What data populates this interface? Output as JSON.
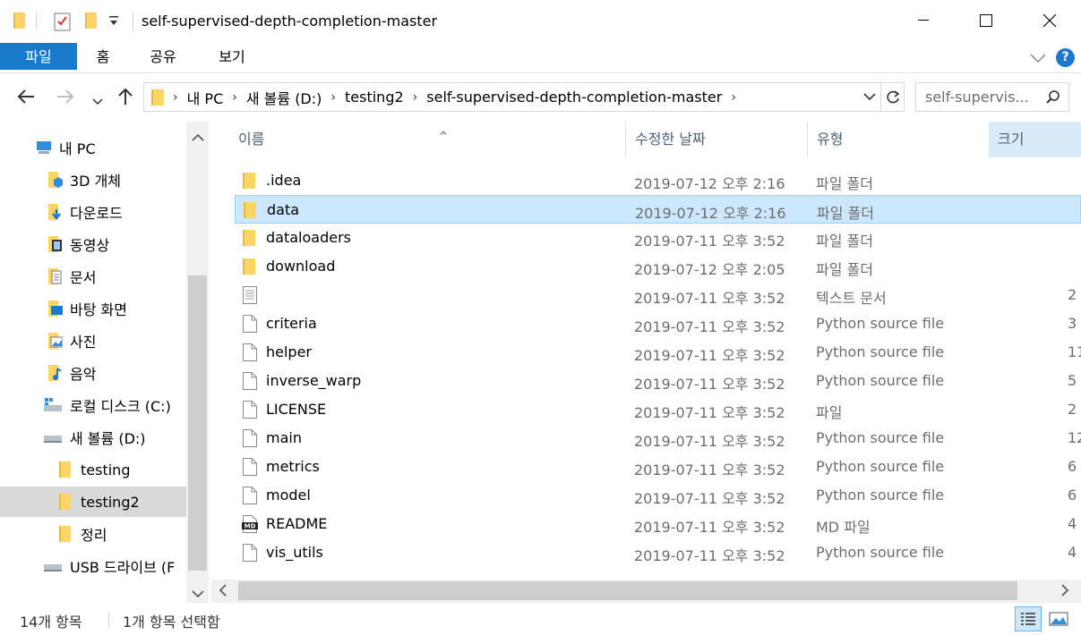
{
  "window": {
    "title": "self-supervised-depth-completion-master"
  },
  "ribbon": {
    "tabs": [
      "파일",
      "홈",
      "공유",
      "보기"
    ]
  },
  "address": {
    "crumbs": [
      "내 PC",
      "새 볼륨 (D:)",
      "testing2",
      "self-supervised-depth-completion-master"
    ]
  },
  "search": {
    "placeholder": "self-supervis..."
  },
  "tree": [
    {
      "label": "내 PC",
      "icon": "computer-icon"
    },
    {
      "label": "3D 개체",
      "icon": "3d-objects-icon"
    },
    {
      "label": "다운로드",
      "icon": "downloads-icon"
    },
    {
      "label": "동영상",
      "icon": "videos-icon"
    },
    {
      "label": "문서",
      "icon": "documents-icon"
    },
    {
      "label": "바탕 화면",
      "icon": "desktop-icon"
    },
    {
      "label": "사진",
      "icon": "pictures-icon"
    },
    {
      "label": "음악",
      "icon": "music-icon"
    },
    {
      "label": "로컬 디스크 (C:)",
      "icon": "drive-icon"
    },
    {
      "label": "새 볼륨 (D:)",
      "icon": "drive-icon"
    },
    {
      "label": "testing",
      "icon": "folder-icon"
    },
    {
      "label": "testing2",
      "icon": "folder-icon"
    },
    {
      "label": "정리",
      "icon": "folder-icon"
    },
    {
      "label": "USB 드라이브 (F",
      "icon": "usb-drive-icon"
    }
  ],
  "columns": {
    "name": "이름",
    "date": "수정한 날짜",
    "type": "유형",
    "size": "크기"
  },
  "files": [
    {
      "name": ".idea",
      "date": "2019-07-12 오후 2:16",
      "type": "파일 폴더",
      "size": "",
      "icon": "folder"
    },
    {
      "name": "data",
      "date": "2019-07-12 오후 2:16",
      "type": "파일 폴더",
      "size": "",
      "icon": "folder"
    },
    {
      "name": "dataloaders",
      "date": "2019-07-11 오후 3:52",
      "type": "파일 폴더",
      "size": "",
      "icon": "folder"
    },
    {
      "name": "download",
      "date": "2019-07-12 오후 2:05",
      "type": "파일 폴더",
      "size": "",
      "icon": "folder"
    },
    {
      "name": "",
      "date": "2019-07-11 오후 3:52",
      "type": "텍스트 문서",
      "size": "2",
      "icon": "text"
    },
    {
      "name": "criteria",
      "date": "2019-07-11 오후 3:52",
      "type": "Python source file",
      "size": "3",
      "icon": "file"
    },
    {
      "name": "helper",
      "date": "2019-07-11 오후 3:52",
      "type": "Python source file",
      "size": "11",
      "icon": "file"
    },
    {
      "name": "inverse_warp",
      "date": "2019-07-11 오후 3:52",
      "type": "Python source file",
      "size": "5",
      "icon": "file"
    },
    {
      "name": "LICENSE",
      "date": "2019-07-11 오후 3:52",
      "type": "파일",
      "size": "2",
      "icon": "file"
    },
    {
      "name": "main",
      "date": "2019-07-11 오후 3:52",
      "type": "Python source file",
      "size": "12",
      "icon": "file"
    },
    {
      "name": "metrics",
      "date": "2019-07-11 오후 3:52",
      "type": "Python source file",
      "size": "6",
      "icon": "file"
    },
    {
      "name": "model",
      "date": "2019-07-11 오후 3:52",
      "type": "Python source file",
      "size": "6",
      "icon": "file"
    },
    {
      "name": "README",
      "date": "2019-07-11 오후 3:52",
      "type": "MD 파일",
      "size": "4",
      "icon": "md"
    },
    {
      "name": "vis_utils",
      "date": "2019-07-11 오후 3:52",
      "type": "Python source file",
      "size": "4",
      "icon": "file"
    }
  ],
  "status": {
    "count": "14개 항목",
    "selected": "1개 항목 선택함"
  },
  "md_badge": "MD",
  "colors": {
    "file_tab": "#1979ca",
    "selection": "#cce8ff",
    "folder": "#ffd467"
  }
}
